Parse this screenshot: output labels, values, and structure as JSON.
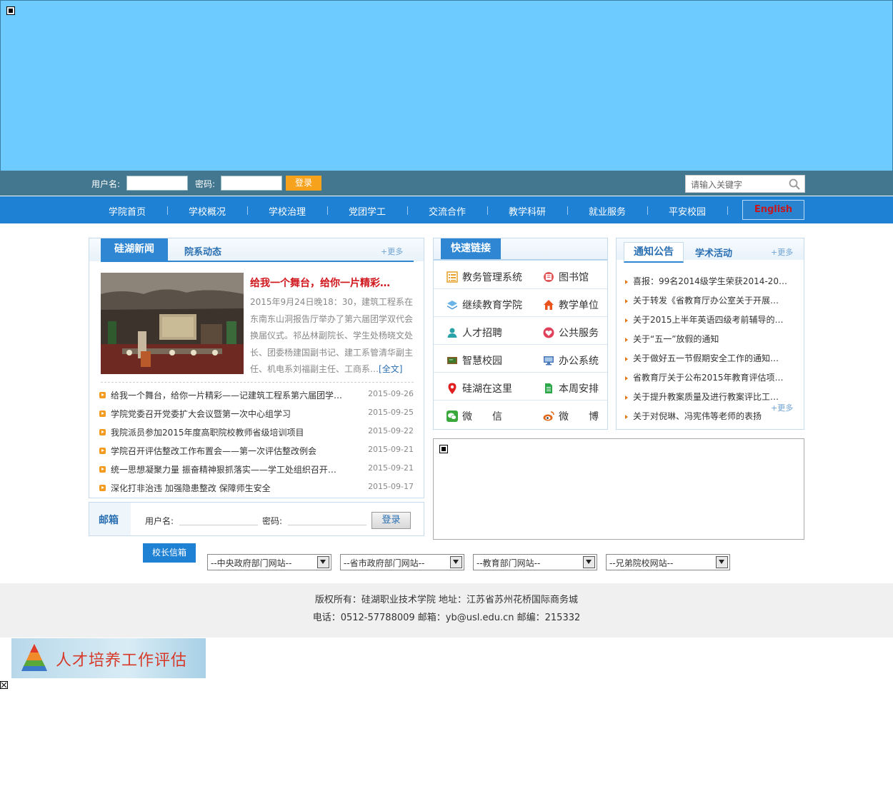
{
  "login": {
    "username_label": "用户名:",
    "password_label": "密码:",
    "login_button": "登录",
    "search_placeholder": "请输入关键字"
  },
  "nav": {
    "items": [
      "学院首页",
      "学校概况",
      "学校治理",
      "党团学工",
      "交流合作",
      "教学科研",
      "就业服务",
      "平安校园"
    ],
    "english": "English"
  },
  "news": {
    "tab_active": "硅湖新闻",
    "tab_inactive": "院系动态",
    "more": "+更多",
    "headline": "给我一个舞台，给你一片精彩…",
    "summary": "2015年9月24日晚18：30，建筑工程系在东南东山洞报告厅举办了第六届团学双代会换届仪式。祁丛林副院长、学生处杨晓文处长、团委杨建国副书记、建工系管清华副主任、机电系刘福副主任、工商系…",
    "full_text": "[全文]",
    "items": [
      {
        "title": "给我一个舞台，给你一片精彩——记建筑工程系第六届团学…",
        "date": "2015-09-26"
      },
      {
        "title": "学院党委召开党委扩大会议暨第一次中心组学习",
        "date": "2015-09-25"
      },
      {
        "title": "我院派员参加2015年度高职院校教师省级培训项目",
        "date": "2015-09-22"
      },
      {
        "title": "学院召开评估整改工作布置会——第一次评估整改例会",
        "date": "2015-09-21"
      },
      {
        "title": "统一思想凝聚力量 振奋精神狠抓落实——学工处组织召开…",
        "date": "2015-09-21"
      },
      {
        "title": "深化打非治违 加强隐患整改 保障师生安全",
        "date": "2015-09-17"
      }
    ]
  },
  "mail": {
    "title": "邮箱",
    "username_label": "用户名:",
    "password_label": "密码:",
    "login_button": "登录"
  },
  "quicklinks": {
    "title": "快速链接",
    "items": [
      {
        "label": "教务管理系统",
        "icon": "list-icon",
        "color": "#e6a12a"
      },
      {
        "label": "图书馆",
        "icon": "library-icon",
        "color": "#e05a5a"
      },
      {
        "label": "继续教育学院",
        "icon": "layers-icon",
        "color": "#3a8fd6"
      },
      {
        "label": "教学单位",
        "icon": "home-icon",
        "color": "#e8541c"
      },
      {
        "label": "人才招聘",
        "icon": "person-icon",
        "color": "#2aa3a8"
      },
      {
        "label": "公共服务",
        "icon": "heart-icon",
        "color": "#e0405a"
      },
      {
        "label": "智慧校园",
        "icon": "chalkboard-icon",
        "color": "#3d7a2a"
      },
      {
        "label": "办公系统",
        "icon": "monitor-icon",
        "color": "#4a78b8"
      },
      {
        "label": "硅湖在这里",
        "icon": "location-pin-icon",
        "color": "#e02020"
      },
      {
        "label": "本周安排",
        "icon": "document-icon",
        "color": "#2aa84a"
      },
      {
        "label": "微　　信",
        "icon": "wechat-icon",
        "color": "#3aa83a"
      },
      {
        "label": "微　　博",
        "icon": "weibo-icon",
        "color": "#e0681c"
      }
    ]
  },
  "notices": {
    "tab_active": "通知公告",
    "tab_inactive": "学术活动",
    "more": "+更多",
    "more_bottom": "+更多",
    "items": [
      "喜报：99名2014级学生荣获2014-20…",
      "关于转发《省教育厅办公室关于开展…",
      "关于2015上半年英语四级考前辅导的…",
      "关于“五一”放假的通知",
      "关于做好五一节假期安全工作的通知…",
      "省教育厅关于公布2015年教育评估项…",
      "关于提升教案质量及进行教案评比工…",
      "关于对倪琳、冯宪伟等老师的表扬"
    ]
  },
  "links": {
    "principal_mailbox": "校长信箱",
    "selects": [
      "--中央政府部门网站--",
      "--省市政府部门网站--",
      "--教育部门网站--",
      "--兄弟院校网站--"
    ]
  },
  "footer": {
    "line1": "版权所有：硅湖职业技术学院 地址：江苏省苏州花桥国际商务城",
    "line2": "电话：0512-57788009 邮箱：yb@usl.edu.cn 邮编：215332"
  },
  "float_banner": {
    "text": "人才培养工作评估"
  },
  "colors": {
    "banner": "#6ecbff",
    "login_bar": "#43778f",
    "nav": "#1e81d4",
    "accent_orange": "#f6a21c",
    "headline_red": "#d0161d"
  }
}
